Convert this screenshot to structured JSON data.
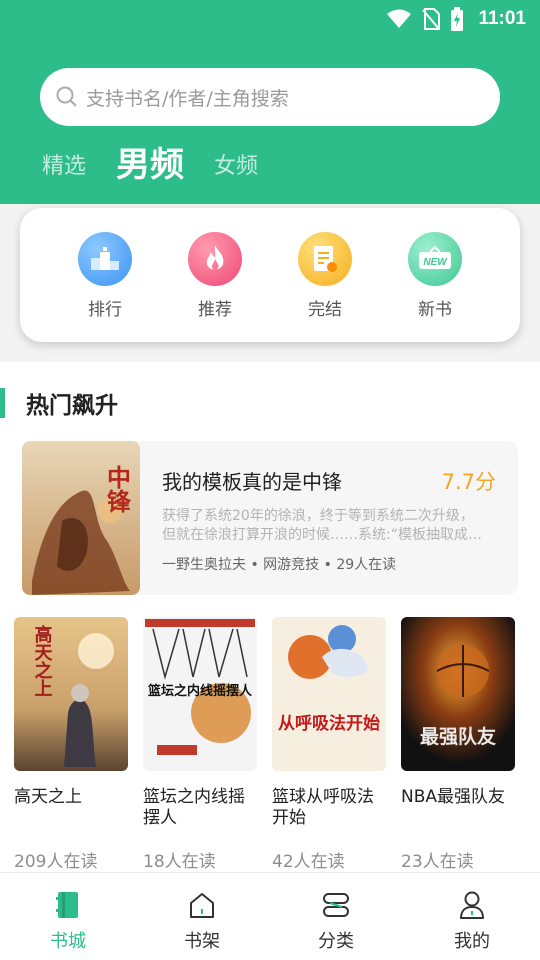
{
  "status_bar": {
    "time": "11:01"
  },
  "search": {
    "placeholder": "支持书名/作者/主角搜索"
  },
  "tabs": [
    {
      "label": "精选"
    },
    {
      "label": "男频"
    },
    {
      "label": "女频"
    }
  ],
  "quick_links": [
    {
      "label": "排行",
      "icon": "ranking-icon",
      "color": "#4fa3f7"
    },
    {
      "label": "推荐",
      "icon": "flame-icon",
      "color": "#f2557a"
    },
    {
      "label": "完结",
      "icon": "document-icon",
      "color": "#f7b52c"
    },
    {
      "label": "新书",
      "icon": "new-badge-icon",
      "color": "#4fd0a1",
      "badge": "NEW"
    }
  ],
  "section": {
    "title": "热门飙升"
  },
  "featured": {
    "title": "我的模板真的是中锋",
    "score": "7.7分",
    "desc_line1": "获得了系统20年的徐浪，终于等到系统二次升级，",
    "desc_line2": "但就在徐浪打算开浪的时候……系统:“模板抽取成…",
    "meta": "一野生奥拉夫 • 网游竞技 • 29人在读",
    "cover_text": "中锋"
  },
  "books": [
    {
      "title": "高天之上",
      "readers": "209人在读",
      "cover_text": "高天之上"
    },
    {
      "title": "篮坛之内线摇摆人",
      "readers": "18人在读",
      "cover_text": "篮坛之内线摇摆人"
    },
    {
      "title": "篮球从呼吸法开始",
      "readers": "42人在读",
      "cover_text": "从呼吸法开始"
    },
    {
      "title": "NBA最强队友",
      "readers": "23人在读",
      "cover_text": "最强队友"
    }
  ],
  "nav": [
    {
      "label": "书城",
      "icon": "bookstore-icon",
      "active": true
    },
    {
      "label": "书架",
      "icon": "bookshelf-icon"
    },
    {
      "label": "分类",
      "icon": "category-icon"
    },
    {
      "label": "我的",
      "icon": "profile-icon"
    }
  ],
  "colors": {
    "brand": "#2dbd8a",
    "score": "#f5a623"
  }
}
